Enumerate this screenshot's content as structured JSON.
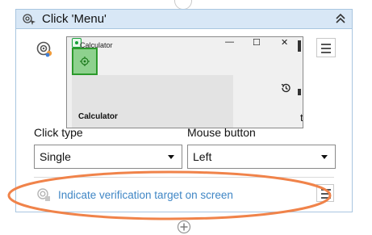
{
  "activity": {
    "title": "Click 'Menu'"
  },
  "preview": {
    "window_title": "Calculator",
    "app_name": "Calculator",
    "controls": {
      "minimize": "—",
      "maximize": "☐",
      "close": "✕"
    }
  },
  "fields": {
    "click_type_label": "Click type",
    "click_type_value": "Single",
    "mouse_button_label": "Mouse button",
    "mouse_button_value": "Left"
  },
  "verification": {
    "link_text": "Indicate verification target on screen"
  },
  "colors": {
    "header_bg": "#d8e7f6",
    "border": "#a9c6e0",
    "link": "#3f86c5",
    "annotation_oval": "#f0834a",
    "highlight_green": "#8ed18e"
  }
}
